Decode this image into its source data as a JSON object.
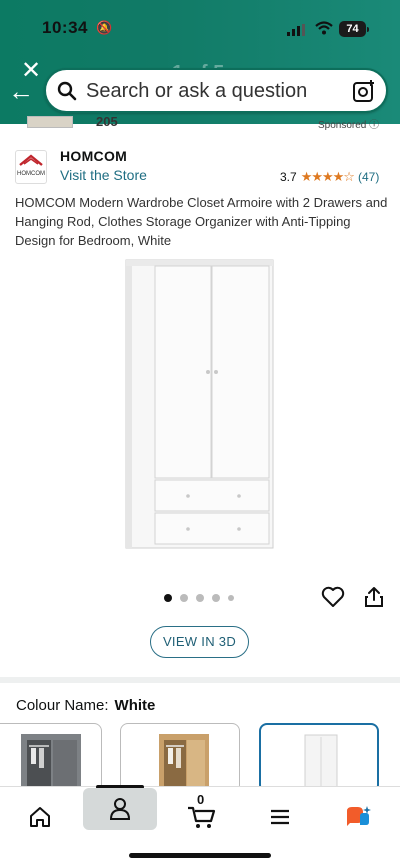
{
  "status_bar": {
    "time": "10:34",
    "battery": "74"
  },
  "search": {
    "placeholder": "Search or ask a question"
  },
  "peek": {
    "number": "205",
    "sponsored": "Sponsored"
  },
  "store": {
    "name": "HOMCOM",
    "link": "Visit the Store",
    "logo_text": "HOMCOM"
  },
  "rating": {
    "value": "3.7",
    "stars": "★★★★☆",
    "count": "(47)",
    "score": 3.7
  },
  "product": {
    "title": "HOMCOM Modern Wardrobe Closet Armoire with 2 Drawers and Hanging Rod, Clothes Storage Organizer with Anti-Tipping Design for Bedroom, White"
  },
  "gallery": {
    "dot_count": 5,
    "active_index": 0
  },
  "buttons": {
    "view_3d": "VIEW IN 3D"
  },
  "colour": {
    "label": "Colour Name:",
    "value": "White"
  },
  "swatches": [
    {
      "name": "Grey",
      "color": "#8a8d90"
    },
    {
      "name": "Oak",
      "color": "#c9a06a"
    },
    {
      "name": "White",
      "color": "#f2f2f2",
      "selected": true
    }
  ],
  "nav": {
    "cart_count": "0"
  },
  "colors": {
    "header": "#0c7a63",
    "link": "#1f6e83",
    "star": "#de7921",
    "swatch_selected": "#1a6fa3"
  }
}
